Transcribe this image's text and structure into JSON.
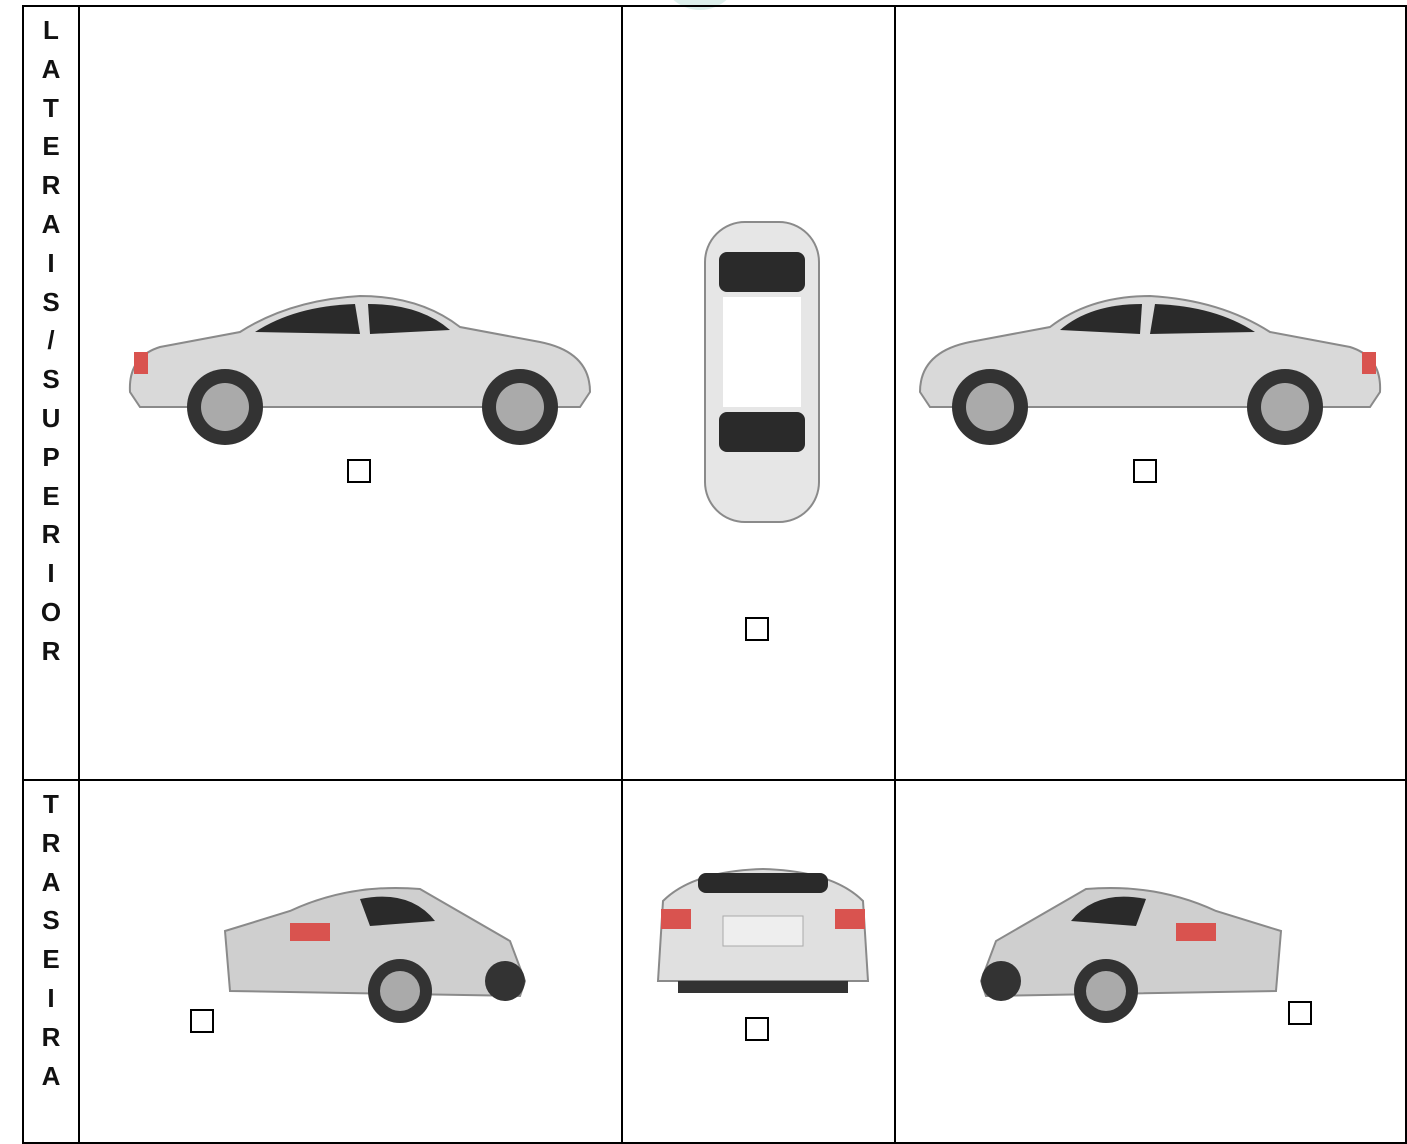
{
  "sections": {
    "top_label": "LATERAIS/SUPERIOR",
    "bottom_label": "TRASEIRA"
  },
  "colors": {
    "car_body": "#d9d9d9",
    "car_shadow": "#8a8a8a",
    "glass": "#2a2a2a",
    "taillight": "#d9534f",
    "border": "#000000"
  },
  "views": [
    {
      "name": "left-side",
      "checked": false
    },
    {
      "name": "top",
      "checked": false
    },
    {
      "name": "right-side",
      "checked": false
    },
    {
      "name": "rear-left-quarter",
      "checked": false
    },
    {
      "name": "rear",
      "checked": false
    },
    {
      "name": "rear-right-quarter",
      "checked": false
    }
  ]
}
